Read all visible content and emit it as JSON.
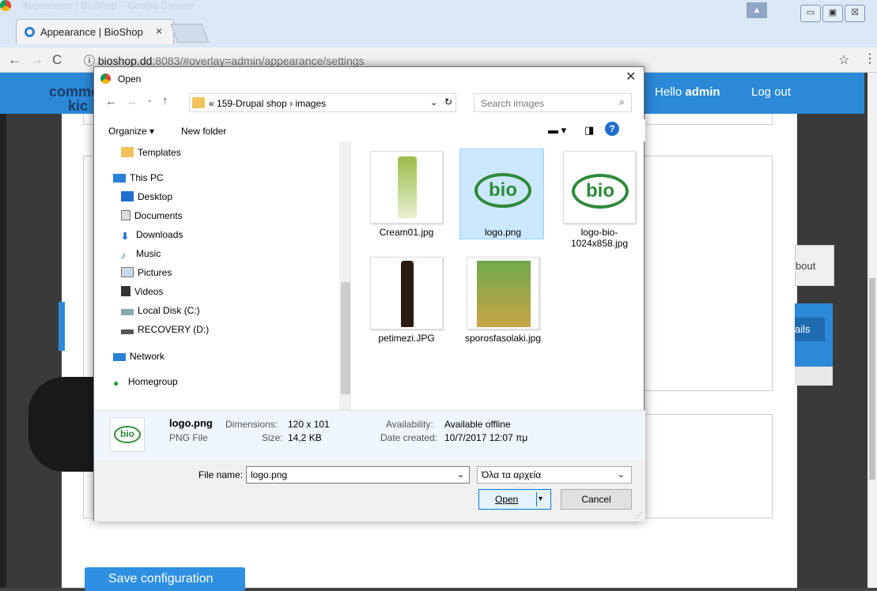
{
  "browser": {
    "window_title": "Appearance | BioShop – Google Chrome",
    "tab_title": "Appearance | BioShop",
    "url_host": "bioshop.dd",
    "url_rest": ":8083/#overlay=admin/appearance/settings"
  },
  "site": {
    "logo_line1": "comme",
    "logo_line2": "kic",
    "hello": "Hello",
    "user": "admin",
    "logout": "Log out",
    "about": "bout",
    "details": "ails",
    "save": "Save configuration"
  },
  "dialog": {
    "title": "Open",
    "path": [
      "«",
      "159-Drupal shop",
      "›",
      "images"
    ],
    "search_placeholder": "Search images",
    "organize": "Organize ▾",
    "new_folder": "New folder",
    "tree": [
      {
        "label": "Templates",
        "icon": "folder-icon"
      },
      {
        "label": "This PC",
        "icon": "pc-icon"
      },
      {
        "label": "Desktop",
        "icon": "desktop-icon"
      },
      {
        "label": "Documents",
        "icon": "documents-icon"
      },
      {
        "label": "Downloads",
        "icon": "downloads-icon"
      },
      {
        "label": "Music",
        "icon": "music-icon"
      },
      {
        "label": "Pictures",
        "icon": "pictures-icon"
      },
      {
        "label": "Videos",
        "icon": "videos-icon"
      },
      {
        "label": "Local Disk (C:)",
        "icon": "disk-icon"
      },
      {
        "label": "RECOVERY (D:)",
        "icon": "drive-icon"
      },
      {
        "label": "Network",
        "icon": "network-icon"
      },
      {
        "label": "Homegroup",
        "icon": "homegroup-icon"
      }
    ],
    "files": [
      "Cream01.jpg",
      "logo.png",
      "logo-bio-1024x858.jpg",
      "petimezi.JPG",
      "sporosfasolaki.jpg"
    ],
    "details": {
      "name": "logo.png",
      "dim_label": "Dimensions:",
      "dim": "120 x 101",
      "type": "PNG File",
      "size_label": "Size:",
      "size": "14,2 KB",
      "avail_label": "Availability:",
      "avail": "Available offline",
      "date_label": "Date created:",
      "date": "10/7/2017 12:07 πμ"
    },
    "file_name_label": "File name:",
    "file_name": "logo.png",
    "file_type": "Όλα τα αρχεία",
    "open": "Open",
    "cancel": "Cancel"
  },
  "colors": {
    "drupal_blue": "#2b89d8",
    "selection": "#cce8ff"
  }
}
